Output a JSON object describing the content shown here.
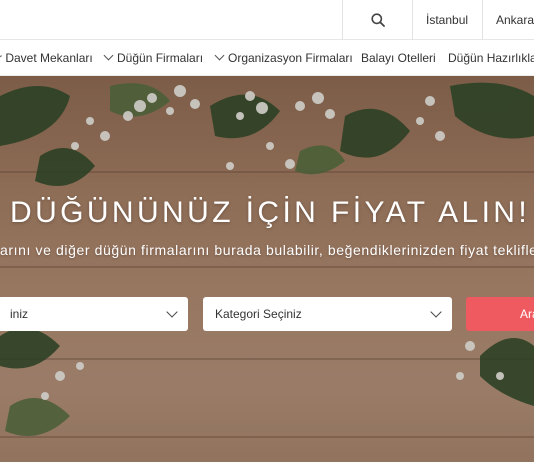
{
  "header": {
    "search_icon": "search-icon",
    "cities": [
      "İstanbul",
      "Ankara"
    ]
  },
  "nav": {
    "items": [
      {
        "label": "r Davet Mekanları",
        "has_chevron": false
      },
      {
        "label": "Düğün Firmaları",
        "has_chevron": true
      },
      {
        "label": "Organizasyon Firmaları",
        "has_chevron": true
      },
      {
        "label": "Balayı Otelleri",
        "has_chevron": false
      },
      {
        "label": "Düğün Hazırlıkları",
        "has_chevron": false
      }
    ]
  },
  "hero": {
    "title": "DÜĞÜNÜNÜZ İÇİN FİYAT ALIN!",
    "subtitle": "arını ve diğer düğün firmalarını burada bulabilir, beğendiklerinizden fiyat teklifle",
    "location_select": "iniz",
    "category_select": "Kategori Seçiniz",
    "submit_label": "Ara"
  },
  "colors": {
    "accent": "#ee5a5f",
    "nav_text": "#333333"
  }
}
